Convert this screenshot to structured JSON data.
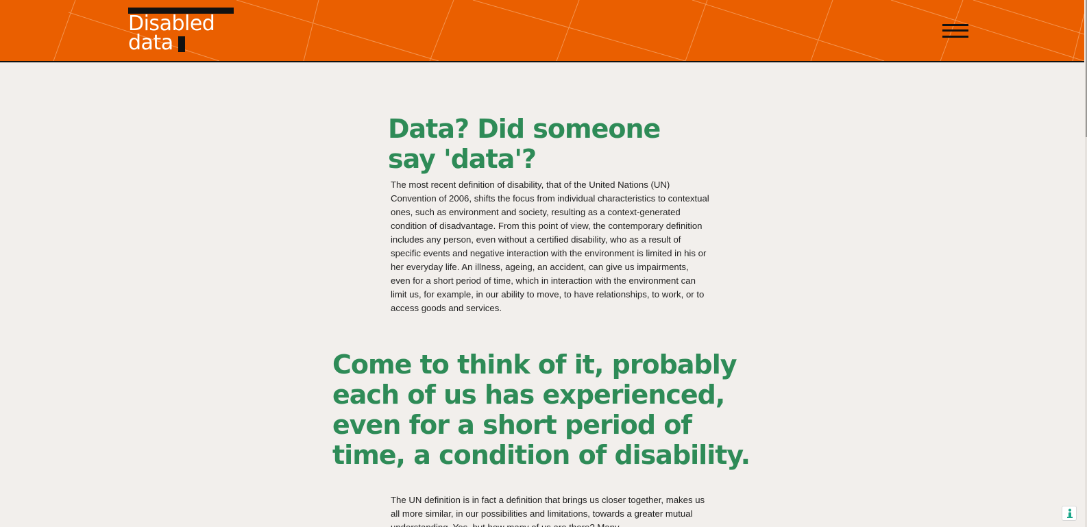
{
  "header": {
    "logo": {
      "line1": "Disabled",
      "line2": "data"
    },
    "menu_icon": "hamburger-menu-icon"
  },
  "content": {
    "heading_1": "Data? Did someone say 'data'?",
    "paragraph_1": "The most recent definition of disability, that of the United Nations (UN) Convention of 2006, shifts the focus from individual characteristics to contextual ones, such as environment and society, resulting as a context-generated condition of disadvantage. From this point of view, the contemporary definition includes any person, even without a certified disability, who as a result of specific events and negative interaction with the environment is limited in his or her everyday life. An illness, ageing, an accident, can give us impairments, even for a short period of time, which in interaction with the environment can limit us, for example, in our ability to move, to have relationships, to work, or to access goods and services.",
    "heading_2": "Come to think of it, probably each of us has experienced, even for a short period of time, a condition of disability.",
    "paragraph_2": "The UN definition is in fact a definition that brings us closer together, makes us all more similar, in our possibilities and limitations, towards a greater mutual understanding. Yes, but how many of us are there? Many"
  },
  "accessibility_widget": {
    "icon": "accessibility-icon"
  },
  "colors": {
    "header_bg": "#ea5f00",
    "page_bg": "#f2efec",
    "heading": "#2e8b57",
    "text": "#1f1f1f"
  }
}
